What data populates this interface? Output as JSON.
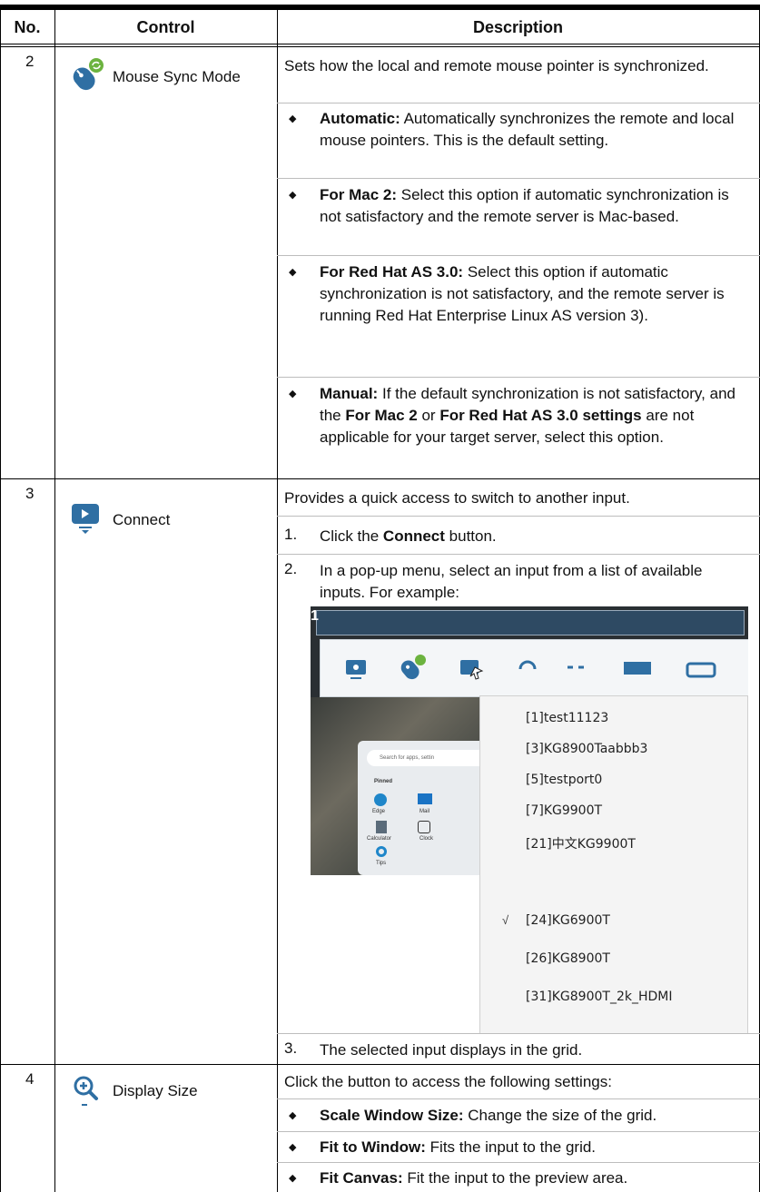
{
  "header": {
    "no": "No.",
    "control": "Control",
    "description": "Description"
  },
  "rows": [
    {
      "no": "2",
      "control": "Mouse Sync Mode",
      "icon": "mouse-sync-icon",
      "intro": "Sets how the local and remote mouse pointer is synchronized.",
      "bullets": [
        {
          "term": "Automatic:",
          "text": "Automatically synchronizes the remote and local mouse pointers. This is the default setting."
        },
        {
          "term": "For Mac 2:",
          "text": "Select this option if automatic synchronization is not satisfactory and the remote server is Mac-based."
        },
        {
          "term": "For Red Hat AS 3.0:",
          "text": "Select this option if automatic synchronization is not satisfactory, and the remote server is running Red Hat Enterprise Linux AS version 3)."
        },
        {
          "term": "Manual:",
          "text_a": "If the default synchronization is not satisfactory, and the",
          "bold_b": "For Mac 2",
          "text_c": "or",
          "bold_d": "For Red Hat AS 3.0 settings",
          "text_e": "are not applicable for your target server, select this option."
        }
      ]
    },
    {
      "no": "3",
      "control": "Connect",
      "icon": "connect-monitor-icon",
      "intro": "Provides a quick access to switch to another input.",
      "steps": [
        {
          "n": "1.",
          "pre": "Click the",
          "bold": "Connect",
          "post": "button."
        },
        {
          "n": "2.",
          "text": "In a pop-up menu, select an input from a list of available inputs. For example:"
        },
        {
          "n": "3.",
          "text": "The selected input displays in the grid."
        }
      ],
      "screenshot": {
        "corner": "1",
        "search_placeholder": "Search for apps, settin",
        "pinned": "Pinned",
        "apps": [
          "Edge",
          "Mail",
          "Calculator",
          "Clock",
          "Tips"
        ],
        "menu_items": [
          "[1]test11123",
          "[3]KG8900Taabbb3",
          "[5]testport0",
          "[7]KG9900T",
          "[21]中文KG9900T",
          "[24]KG6900T",
          "[26]KG8900T",
          "[31]KG8900T_2k_HDMI"
        ],
        "checked_mark": "√"
      }
    },
    {
      "no": "4",
      "control": "Display Size",
      "icon": "zoom-in-icon",
      "intro": "Click the button to access the following settings:",
      "bullets": [
        {
          "term": "Scale Window Size:",
          "text": "Change the size of the grid."
        },
        {
          "term": "Fit to Window:",
          "text": "Fits the input to the grid."
        },
        {
          "term": "Fit Canvas:",
          "text": "Fit the input to the preview area."
        }
      ]
    }
  ],
  "colors": {
    "icon_blue": "#2f6fa3",
    "icon_green": "#6cb33f",
    "rule": "#000000",
    "separator": "#bdbdbd"
  }
}
